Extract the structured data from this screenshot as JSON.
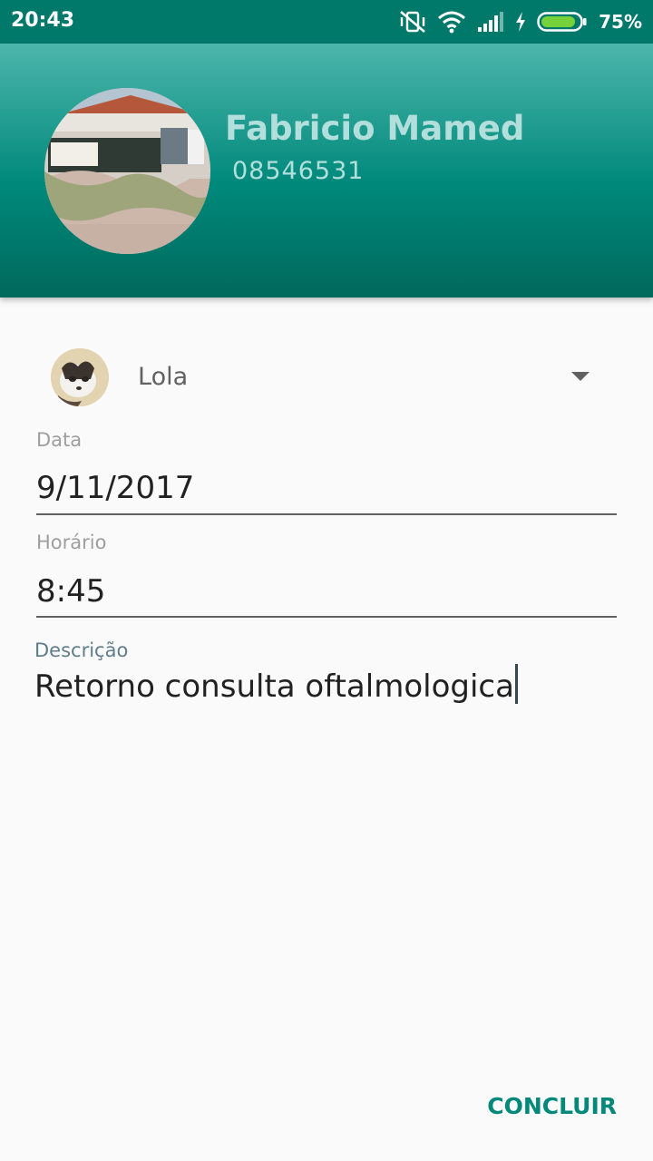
{
  "status_bar": {
    "time": "20:43",
    "battery_percent": "75%",
    "icons": [
      "vibrate-off-icon",
      "wifi-icon",
      "signal-icon",
      "charging-icon",
      "battery-icon"
    ],
    "battery_level": 0.75,
    "background_color": "#00796b"
  },
  "profile": {
    "name": "Fabricio Mamed",
    "phone": "08546531",
    "header_color": "#00897b"
  },
  "form": {
    "pet_selector": {
      "selected": "Lola"
    },
    "date": {
      "label": "Data",
      "value": "9/11/2017"
    },
    "time": {
      "label": "Horário",
      "value": "8:45"
    },
    "description": {
      "label": "Descrição",
      "value": "Retorno consulta oftalmologica"
    }
  },
  "actions": {
    "submit_label": "CONCLUIR",
    "accent_color": "#00897b"
  }
}
